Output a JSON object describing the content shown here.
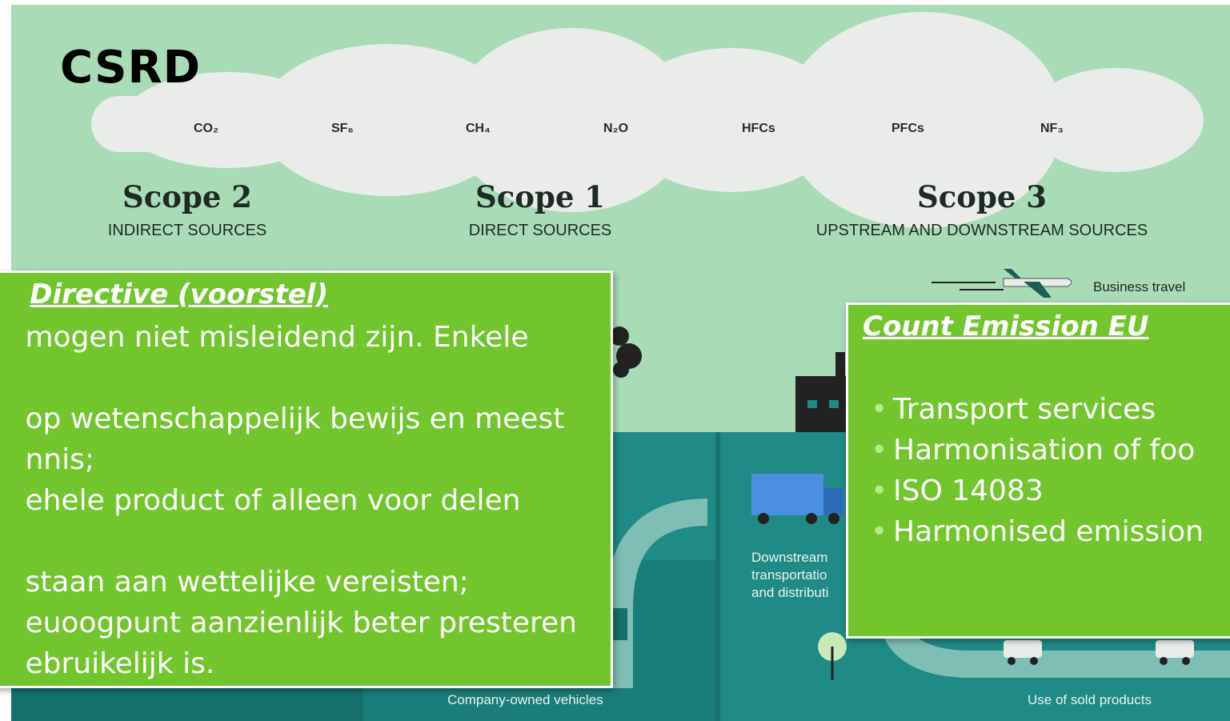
{
  "slide": {
    "title": "CSRD"
  },
  "infographic": {
    "gases": [
      "CO₂",
      "SF₆",
      "CH₄",
      "N₂O",
      "HFCs",
      "PFCs",
      "NF₃"
    ],
    "scopes": [
      {
        "title": "Scope 2",
        "subtitle": "INDIRECT SOURCES"
      },
      {
        "title": "Scope 1",
        "subtitle": "DIRECT SOURCES"
      },
      {
        "title": "Scope 3",
        "subtitle": "UPSTREAM AND DOWNSTREAM SOURCES"
      }
    ],
    "labels": {
      "business_travel": "Business travel",
      "downstream_line1": "Downstream",
      "downstream_line2": "transportatio",
      "downstream_line3": "and distributi",
      "company_vehicles": "Company-owned vehicles",
      "sold_products": "Use of sold products"
    },
    "icons": [
      "cloud-icon",
      "airplane-icon",
      "factory-icon",
      "truck-icon",
      "tree-icon",
      "car-icon"
    ],
    "colors": {
      "background": "#a9dcb6",
      "cloud": "#e9ece9",
      "sea": "#1f8a86",
      "sea_dark": "#16706c",
      "callout": "#72c52d",
      "callout_text": "#ffffff"
    }
  },
  "callout_left": {
    "heading": "Directive (voorstel)",
    "lines": [
      "mogen niet misleidend zijn. Enkele",
      "",
      "op wetenschappelijk bewijs en meest",
      "nnis;",
      "ehele product of alleen voor delen",
      "",
      "staan aan wettelijke vereisten;",
      "euoogpunt aanzienlijk beter presteren",
      "ebruikelijk is."
    ]
  },
  "callout_right": {
    "heading": "Count Emission EU",
    "items": [
      "Transport services",
      "Harmonisation of foo",
      "ISO 14083",
      "Harmonised emission"
    ]
  }
}
